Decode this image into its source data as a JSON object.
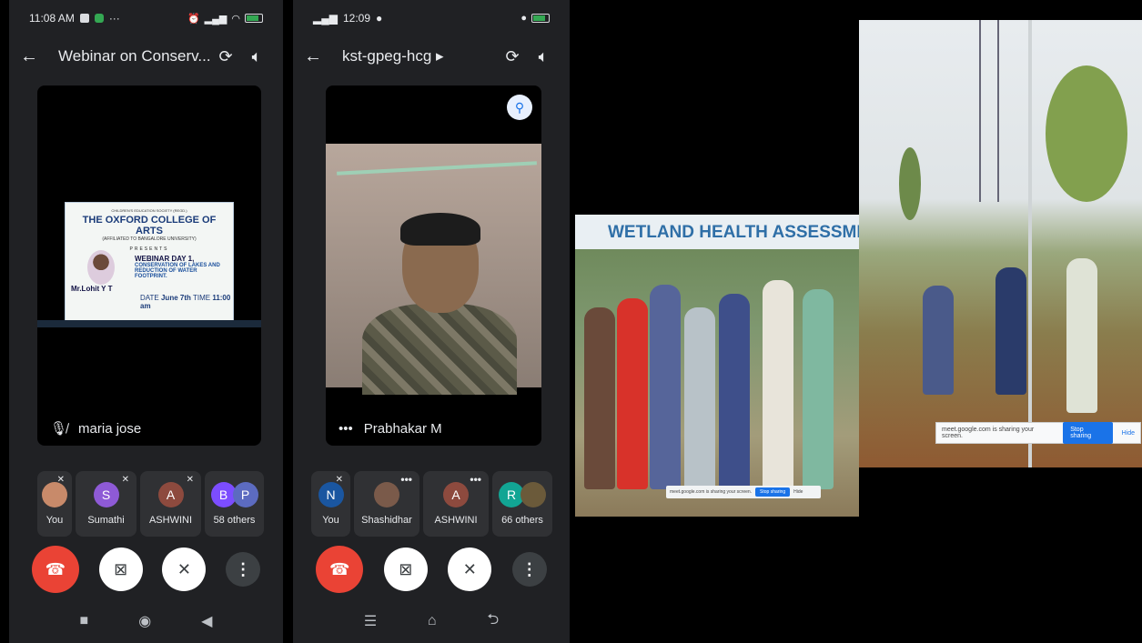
{
  "phone1": {
    "status": {
      "time": "11:08 AM",
      "more": "···"
    },
    "toolbar": {
      "title": "Webinar on Conserv... ▸"
    },
    "main_tile": {
      "name": "maria jose"
    },
    "slide": {
      "line1": "CHILDREN'S EDUCATION SOCIETY (REGD.)",
      "college": "THE OXFORD COLLEGE OF ARTS",
      "affiliation": "(AFFILIATED TO BANGALORE UNIVERSITY)",
      "presents": "PRESENTS",
      "day": "WEBINAR DAY 1,",
      "topic": "CONSERVATION OF LAKES AND REDUCTION OF WATER FOOTPRINT.",
      "speaker": "Mr.Lohit Y T",
      "date_label": "DATE",
      "date": "June 7th",
      "time_label": "TIME",
      "time": "11:00 am"
    },
    "participants": [
      {
        "label": "You",
        "initial": "",
        "color": "#c88a6a"
      },
      {
        "label": "Sumathi",
        "initial": "S",
        "color": "#8e5ad6"
      },
      {
        "label": "ASHWINI",
        "initial": "A",
        "color": "#8d4a3e"
      },
      {
        "label": "58 others",
        "initial1": "B",
        "initial2": "P",
        "color1": "#7c4dff",
        "color2": "#5c6bc0"
      }
    ]
  },
  "phone2": {
    "status": {
      "time": "12:09"
    },
    "toolbar": {
      "title": "kst-gpeg-hcg ▸"
    },
    "main_tile": {
      "name": "Prabhakar M",
      "more": "•••"
    },
    "participants": [
      {
        "label": "You",
        "initial": "N",
        "color": "#1a56a0"
      },
      {
        "label": "Shashidhar",
        "more": "•••"
      },
      {
        "label": "ASHWINI",
        "initial": "A",
        "color": "#8d4a3e",
        "more": "•••"
      },
      {
        "label": "66 others",
        "initial1": "R",
        "color1": "#12a594"
      }
    ]
  },
  "wetland": {
    "banner": "WETLAND HEALTH ASSESSMEN",
    "share_text": "meet.google.com is sharing your screen.",
    "stop": "Stop sharing",
    "hide": "Hide"
  },
  "plantation": {
    "share_text": "meet.google.com is sharing your screen.",
    "stop": "Stop sharing",
    "hide": "Hide"
  },
  "icons": [
    "back-arrow-icon",
    "switch-camera-icon",
    "speaker-icon",
    "mic-off-icon",
    "end-call-icon",
    "camera-off-icon",
    "more-vert-icon",
    "pin-icon"
  ]
}
